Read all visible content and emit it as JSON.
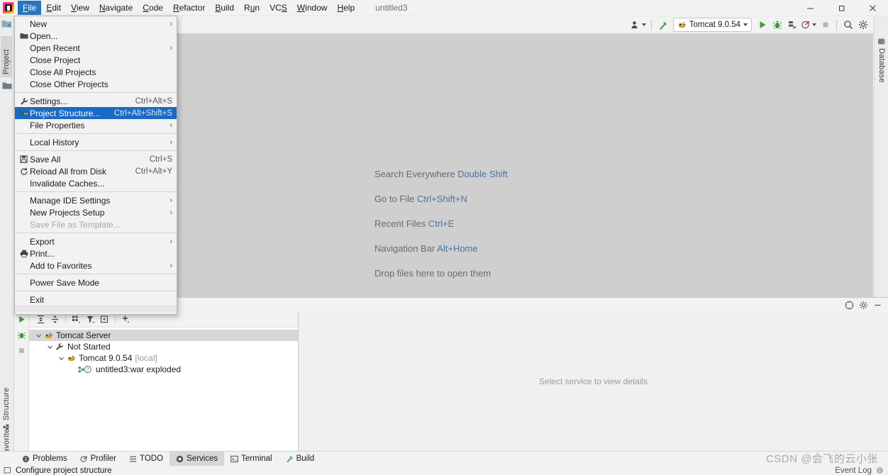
{
  "window": {
    "project_title": "untitled3",
    "controls": {
      "minimize": "—",
      "maximize": "❐",
      "close": "✕"
    }
  },
  "menubar": {
    "items": [
      {
        "label": "File",
        "mnemonic": "F",
        "active": true
      },
      {
        "label": "Edit",
        "mnemonic": "E",
        "active": false
      },
      {
        "label": "View",
        "mnemonic": "V",
        "active": false
      },
      {
        "label": "Navigate",
        "mnemonic": "N",
        "active": false
      },
      {
        "label": "Code",
        "mnemonic": "C",
        "active": false
      },
      {
        "label": "Refactor",
        "mnemonic": "R",
        "active": false
      },
      {
        "label": "Build",
        "mnemonic": "B",
        "active": false
      },
      {
        "label": "Run",
        "mnemonic": "u",
        "active": false
      },
      {
        "label": "VCS",
        "mnemonic": "S",
        "active": false
      },
      {
        "label": "Window",
        "mnemonic": "W",
        "active": false
      },
      {
        "label": "Help",
        "mnemonic": "H",
        "active": false
      }
    ]
  },
  "file_menu": {
    "groups": [
      [
        {
          "label": "New",
          "icon": "none",
          "accel": "",
          "submenu": true,
          "selected": false,
          "disabled": false
        },
        {
          "label": "Open...",
          "icon": "folder",
          "accel": "",
          "submenu": false,
          "selected": false,
          "disabled": false
        },
        {
          "label": "Open Recent",
          "icon": "none",
          "accel": "",
          "submenu": true,
          "selected": false,
          "disabled": false
        },
        {
          "label": "Close Project",
          "icon": "none",
          "accel": "",
          "submenu": false,
          "selected": false,
          "disabled": false
        },
        {
          "label": "Close All Projects",
          "icon": "none",
          "accel": "",
          "submenu": false,
          "selected": false,
          "disabled": false
        },
        {
          "label": "Close Other Projects",
          "icon": "none",
          "accel": "",
          "submenu": false,
          "selected": false,
          "disabled": false
        }
      ],
      [
        {
          "label": "Settings...",
          "icon": "wrench",
          "accel": "Ctrl+Alt+S",
          "submenu": false,
          "selected": false,
          "disabled": false
        },
        {
          "label": "Project Structure...",
          "icon": "modules",
          "accel": "Ctrl+Alt+Shift+S",
          "submenu": false,
          "selected": true,
          "disabled": false
        },
        {
          "label": "File Properties",
          "icon": "none",
          "accel": "",
          "submenu": true,
          "selected": false,
          "disabled": false
        }
      ],
      [
        {
          "label": "Local History",
          "icon": "none",
          "accel": "",
          "submenu": true,
          "selected": false,
          "disabled": false
        }
      ],
      [
        {
          "label": "Save All",
          "icon": "save",
          "accel": "Ctrl+S",
          "submenu": false,
          "selected": false,
          "disabled": false
        },
        {
          "label": "Reload All from Disk",
          "icon": "reload",
          "accel": "Ctrl+Alt+Y",
          "submenu": false,
          "selected": false,
          "disabled": false
        },
        {
          "label": "Invalidate Caches...",
          "icon": "none",
          "accel": "",
          "submenu": false,
          "selected": false,
          "disabled": false
        }
      ],
      [
        {
          "label": "Manage IDE Settings",
          "icon": "none",
          "accel": "",
          "submenu": true,
          "selected": false,
          "disabled": false
        },
        {
          "label": "New Projects Setup",
          "icon": "none",
          "accel": "",
          "submenu": true,
          "selected": false,
          "disabled": false
        },
        {
          "label": "Save File as Template...",
          "icon": "none",
          "accel": "",
          "submenu": false,
          "selected": false,
          "disabled": true
        }
      ],
      [
        {
          "label": "Export",
          "icon": "none",
          "accel": "",
          "submenu": true,
          "selected": false,
          "disabled": false
        },
        {
          "label": "Print...",
          "icon": "printer",
          "accel": "",
          "submenu": false,
          "selected": false,
          "disabled": false
        },
        {
          "label": "Add to Favorites",
          "icon": "none",
          "accel": "",
          "submenu": true,
          "selected": false,
          "disabled": false
        }
      ],
      [
        {
          "label": "Power Save Mode",
          "icon": "none",
          "accel": "",
          "submenu": false,
          "selected": false,
          "disabled": false
        }
      ],
      [
        {
          "label": "Exit",
          "icon": "none",
          "accel": "",
          "submenu": false,
          "selected": false,
          "disabled": false
        }
      ]
    ]
  },
  "toolbar": {
    "run_config": "Tomcat 9.0.54",
    "buttons": [
      "user-icon",
      "hammer-build-icon",
      "run-icon",
      "debug-icon",
      "run-with-coverage-icon",
      "profiler-icon",
      "stop-icon",
      "search-icon",
      "settings-gear-icon",
      "updates-icon"
    ]
  },
  "stripes": {
    "left": [
      {
        "label": "Project",
        "icon": "project-icon",
        "selected": true
      },
      {
        "label": "Structure",
        "icon": "structure-icon",
        "selected": false
      },
      {
        "label": "Favorites",
        "icon": "star-icon",
        "selected": false
      }
    ],
    "right": [
      {
        "label": "Database",
        "icon": "database-icon",
        "selected": false
      }
    ]
  },
  "editor": {
    "hints": [
      {
        "action": "Search Everywhere",
        "shortcut": "Double Shift"
      },
      {
        "action": "Go to File",
        "shortcut": "Ctrl+Shift+N"
      },
      {
        "action": "Recent Files",
        "shortcut": "Ctrl+E"
      },
      {
        "action": "Navigation Bar",
        "shortcut": "Alt+Home"
      },
      {
        "action": "Drop files here to open them",
        "shortcut": ""
      }
    ]
  },
  "services": {
    "title": "Services",
    "header_icons": [
      "help-icon",
      "settings-gear-icon",
      "hide-icon"
    ],
    "run_column_icons": [
      "run-icon",
      "debug-icon",
      "stop-icon"
    ],
    "toolbar_icons": [
      "expand-all-icon",
      "collapse-all-icon",
      "group-by-icon",
      "filter-icon",
      "show-configurations-icon",
      "add-service-icon"
    ],
    "tree": [
      {
        "label": "Tomcat Server",
        "suffix": "",
        "depth": 0,
        "expanded": true,
        "icon": "tomcat-icon",
        "selected": true
      },
      {
        "label": "Not Started",
        "suffix": "",
        "depth": 1,
        "expanded": true,
        "icon": "wrench-icon",
        "selected": false
      },
      {
        "label": "Tomcat 9.0.54",
        "suffix": "[local]",
        "depth": 2,
        "expanded": true,
        "icon": "tomcat-icon",
        "selected": false
      },
      {
        "label": "untitled3:war exploded",
        "suffix": "",
        "depth": 3,
        "expanded": false,
        "icon": "artifact-icon",
        "selected": false
      }
    ],
    "detail_placeholder": "Select service to view details"
  },
  "bottom_tabs": [
    {
      "label": "Problems",
      "icon": "problems-icon",
      "selected": false
    },
    {
      "label": "Profiler",
      "icon": "profiler-icon",
      "selected": false
    },
    {
      "label": "TODO",
      "icon": "todo-icon",
      "selected": false
    },
    {
      "label": "Services",
      "icon": "services-icon",
      "selected": true
    },
    {
      "label": "Terminal",
      "icon": "terminal-icon",
      "selected": false
    },
    {
      "label": "Build",
      "icon": "build-icon",
      "selected": false
    }
  ],
  "statusbar": {
    "message": "Configure project structure",
    "event_log": "Event Log"
  },
  "watermark": "CSDN @会飞的云小张",
  "colors": {
    "accent_blue": "#1a69c4",
    "menu_active_blue": "#2675bf",
    "teal_progress": "#3cbfad",
    "link_blue": "#4a72a8",
    "run_green": "#3d9c35",
    "editor_bg": "#cfcfcf"
  }
}
